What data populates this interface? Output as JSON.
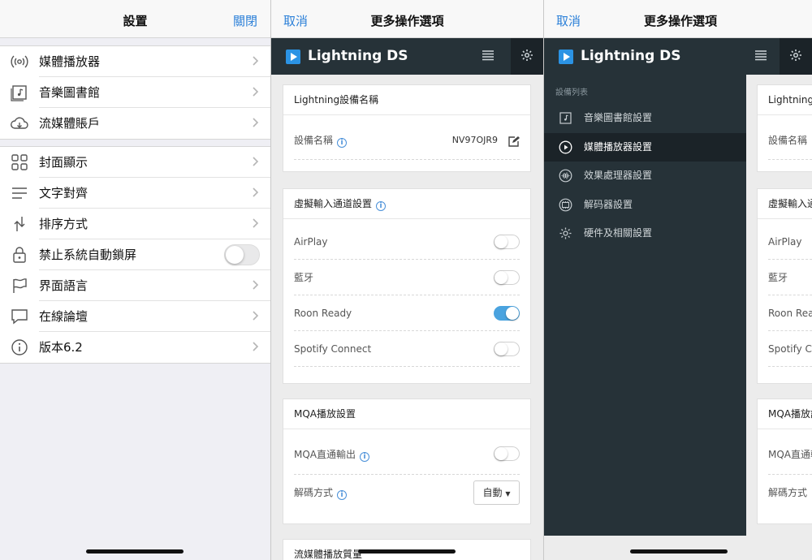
{
  "screen1": {
    "title": "設置",
    "close": "關閉",
    "group1": [
      {
        "label": "媒體播放器",
        "icon": "broadcast-icon"
      },
      {
        "label": "音樂圖書館",
        "icon": "music-library-icon"
      },
      {
        "label": "流媒體賬戶",
        "icon": "cloud-icon"
      }
    ],
    "group2": [
      {
        "label": "封面顯示",
        "icon": "grid-icon"
      },
      {
        "label": "文字對齊",
        "icon": "align-icon"
      },
      {
        "label": "排序方式",
        "icon": "sort-icon"
      },
      {
        "label": "禁止系統自動鎖屏",
        "icon": "lock-icon"
      },
      {
        "label": "界面語言",
        "icon": "flag-icon"
      },
      {
        "label": "在線論壇",
        "icon": "chat-icon"
      },
      {
        "label": "版本6.2",
        "icon": "info-icon"
      }
    ]
  },
  "screen2": {
    "cancel": "取消",
    "title": "更多操作選項",
    "app_title": "Lightning DS",
    "device_card": {
      "header": "Lightning設備名稱",
      "label": "設備名稱",
      "value": "NV97OJR9"
    },
    "virtual_card": {
      "header": "虛擬輸入通道設置",
      "items": [
        {
          "label": "AirPlay",
          "on": false
        },
        {
          "label": "藍牙",
          "on": false
        },
        {
          "label": "Roon Ready",
          "on": true
        },
        {
          "label": "Spotify Connect",
          "on": false
        }
      ]
    },
    "mqa_card": {
      "header": "MQA播放設置",
      "passthrough": "MQA直通輸出",
      "decode": "解碼方式",
      "decode_value": "自動"
    },
    "streaming_card": {
      "header": "流媒體播放質量"
    }
  },
  "screen3": {
    "cancel": "取消",
    "title": "更多操作選項",
    "app_title": "Lightning DS",
    "drawer_section": "設備列表",
    "drawer_items": [
      {
        "label": "音樂圖書館設置",
        "icon": "music-library-icon"
      },
      {
        "label": "媒體播放器設置",
        "icon": "play-circle-icon",
        "active": true
      },
      {
        "label": "效果處理器設置",
        "icon": "waveform-icon"
      },
      {
        "label": "解码器設置",
        "icon": "decoder-icon"
      },
      {
        "label": "硬件及相關設置",
        "icon": "gear-icon"
      }
    ],
    "peek": {
      "c1": "Lightning設",
      "r1": "設備名稱",
      "c2": "虛擬輸入通",
      "airplay": "AirPlay",
      "bt": "藍牙",
      "roon": "Roon Read",
      "spotify": "Spotify Co",
      "mqa": "MQA播放設",
      "mqa1": "MQA直通輸",
      "mqa2": "解碼方式"
    }
  },
  "colors": {
    "accent": "#2a7fd8",
    "toggle_on": "#4aa3df",
    "header_bg": "#263238"
  }
}
